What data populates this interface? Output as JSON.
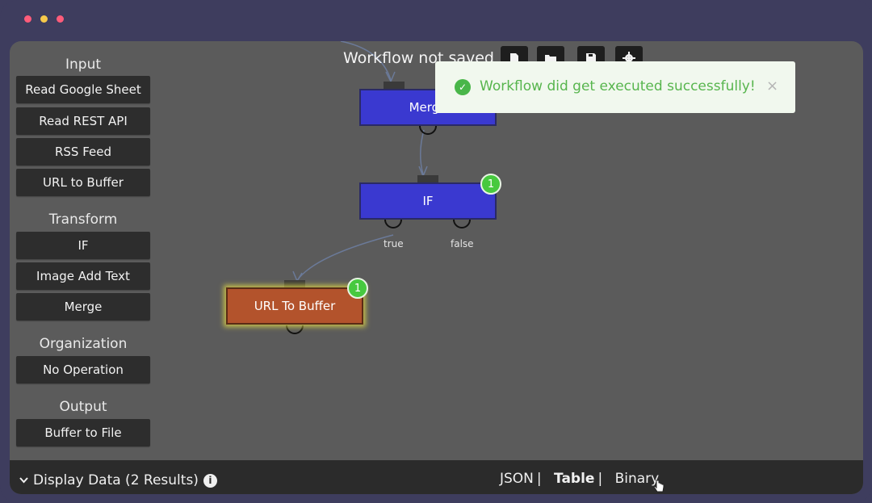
{
  "window": {
    "controls": [
      "close",
      "minimize",
      "maximize"
    ]
  },
  "sidebar": {
    "sections": [
      {
        "title": "Input",
        "items": [
          "Read Google Sheet",
          "Read REST API",
          "RSS Feed",
          "URL to Buffer"
        ]
      },
      {
        "title": "Transform",
        "items": [
          "IF",
          "Image Add Text",
          "Merge"
        ]
      },
      {
        "title": "Organization",
        "items": [
          "No Operation"
        ]
      },
      {
        "title": "Output",
        "items": [
          "Buffer to File"
        ]
      }
    ]
  },
  "toolbar": {
    "title": "Workflow not saved",
    "buttons": [
      "new-file-icon",
      "open-folder-icon",
      "save-icon",
      "settings-icon"
    ]
  },
  "nodes": {
    "merge": {
      "label": "Merge"
    },
    "if": {
      "label": "IF",
      "badge": "1",
      "outputs": [
        "true",
        "false"
      ]
    },
    "url_to_buffer": {
      "label": "URL To Buffer",
      "badge": "1"
    }
  },
  "toast": {
    "message": "Workflow did get executed successfully!",
    "close": "×"
  },
  "bottombar": {
    "display_data": "Display Data (2 Results)",
    "tabs": [
      "JSON",
      "Table",
      "Binary"
    ],
    "active_tab": "Table"
  },
  "colors": {
    "node_blue": "#3a39d0",
    "node_orange": "#b3532c",
    "badge_green": "#47c93f",
    "toast_text": "#57b54d"
  }
}
